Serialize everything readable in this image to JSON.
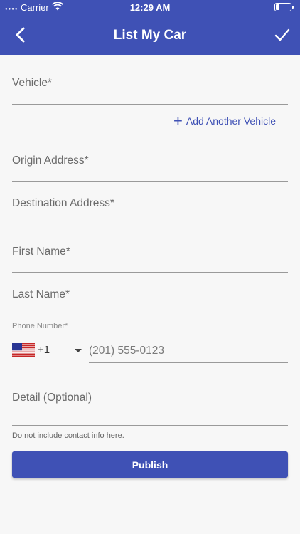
{
  "status_bar": {
    "carrier": "Carrier",
    "time": "12:29 AM"
  },
  "nav": {
    "title": "List My Car",
    "back_icon": "chevron-left-icon",
    "confirm_icon": "checkmark-icon"
  },
  "form": {
    "vehicle_label": "Vehicle*",
    "add_vehicle_label": "Add Another Vehicle",
    "origin_label": "Origin Address*",
    "destination_label": "Destination Address*",
    "first_name_label": "First Name*",
    "last_name_label": "Last Name*",
    "phone_label": "Phone Number*",
    "phone_country_code": "+1",
    "phone_placeholder": "(201) 555-0123",
    "detail_label": "Detail (Optional)",
    "detail_helper": "Do not include contact info here.",
    "publish_label": "Publish"
  },
  "colors": {
    "primary": "#3f51b5",
    "background": "#f7f7f7"
  }
}
